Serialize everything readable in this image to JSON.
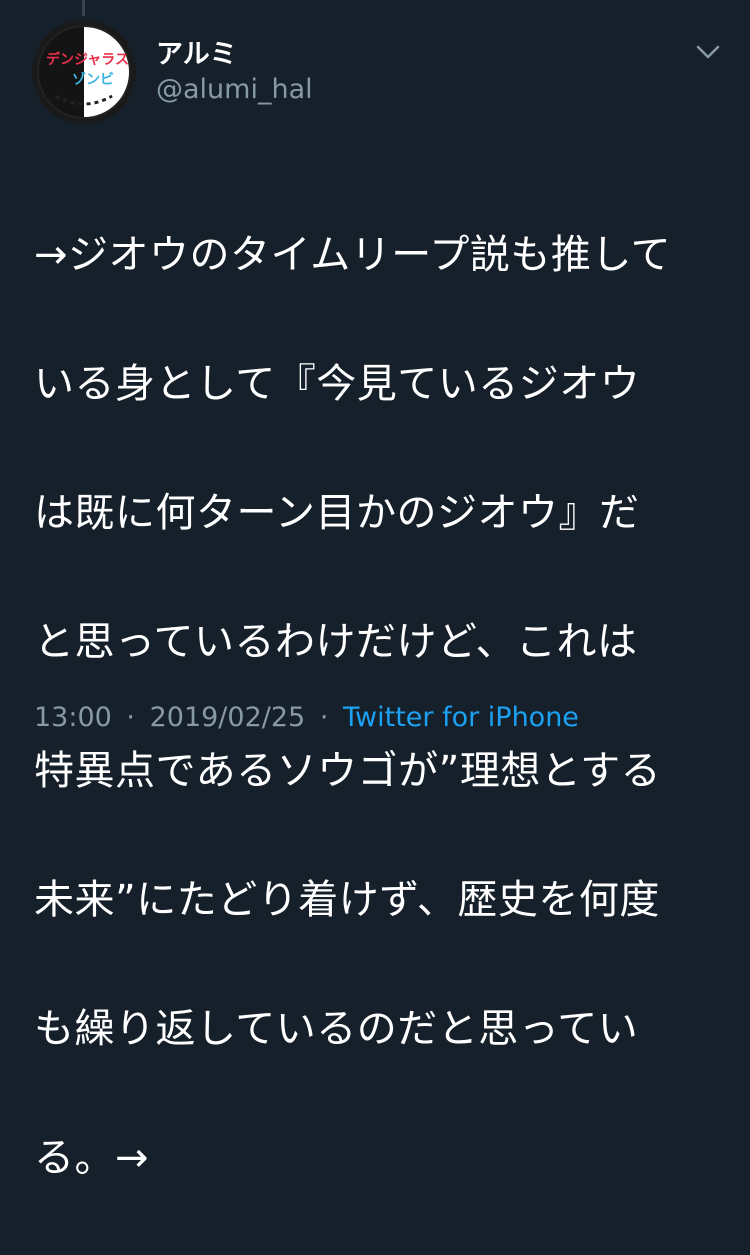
{
  "tweet": {
    "display_name": "アルミ",
    "handle": "@alumi_hal",
    "avatar_icon": "avatar-icon",
    "avatar_logo_text": [
      "デンジャラス",
      "ゾンビ"
    ],
    "text_lines": [
      "→ジオウのタイムリープ説も推して",
      "いる身として『今見ているジオウ",
      "は既に何ターン目かのジオウ』だ",
      "と思っているわけだけど、これは",
      "特異点であるソウゴが”理想とする",
      "未来”にたどり着けず、歴史を何度",
      "も繰り返しているのだと思ってい",
      "る。→"
    ],
    "time": "13:00",
    "separator": "·",
    "date": "2019/02/25",
    "source": "Twitter for iPhone"
  },
  "colors": {
    "background": "#15202b",
    "text": "#ffffff",
    "muted": "#8899a6",
    "link": "#1da1f2",
    "thread_line": "#38444d"
  },
  "icons": {
    "menu": "chevron-down-icon"
  }
}
